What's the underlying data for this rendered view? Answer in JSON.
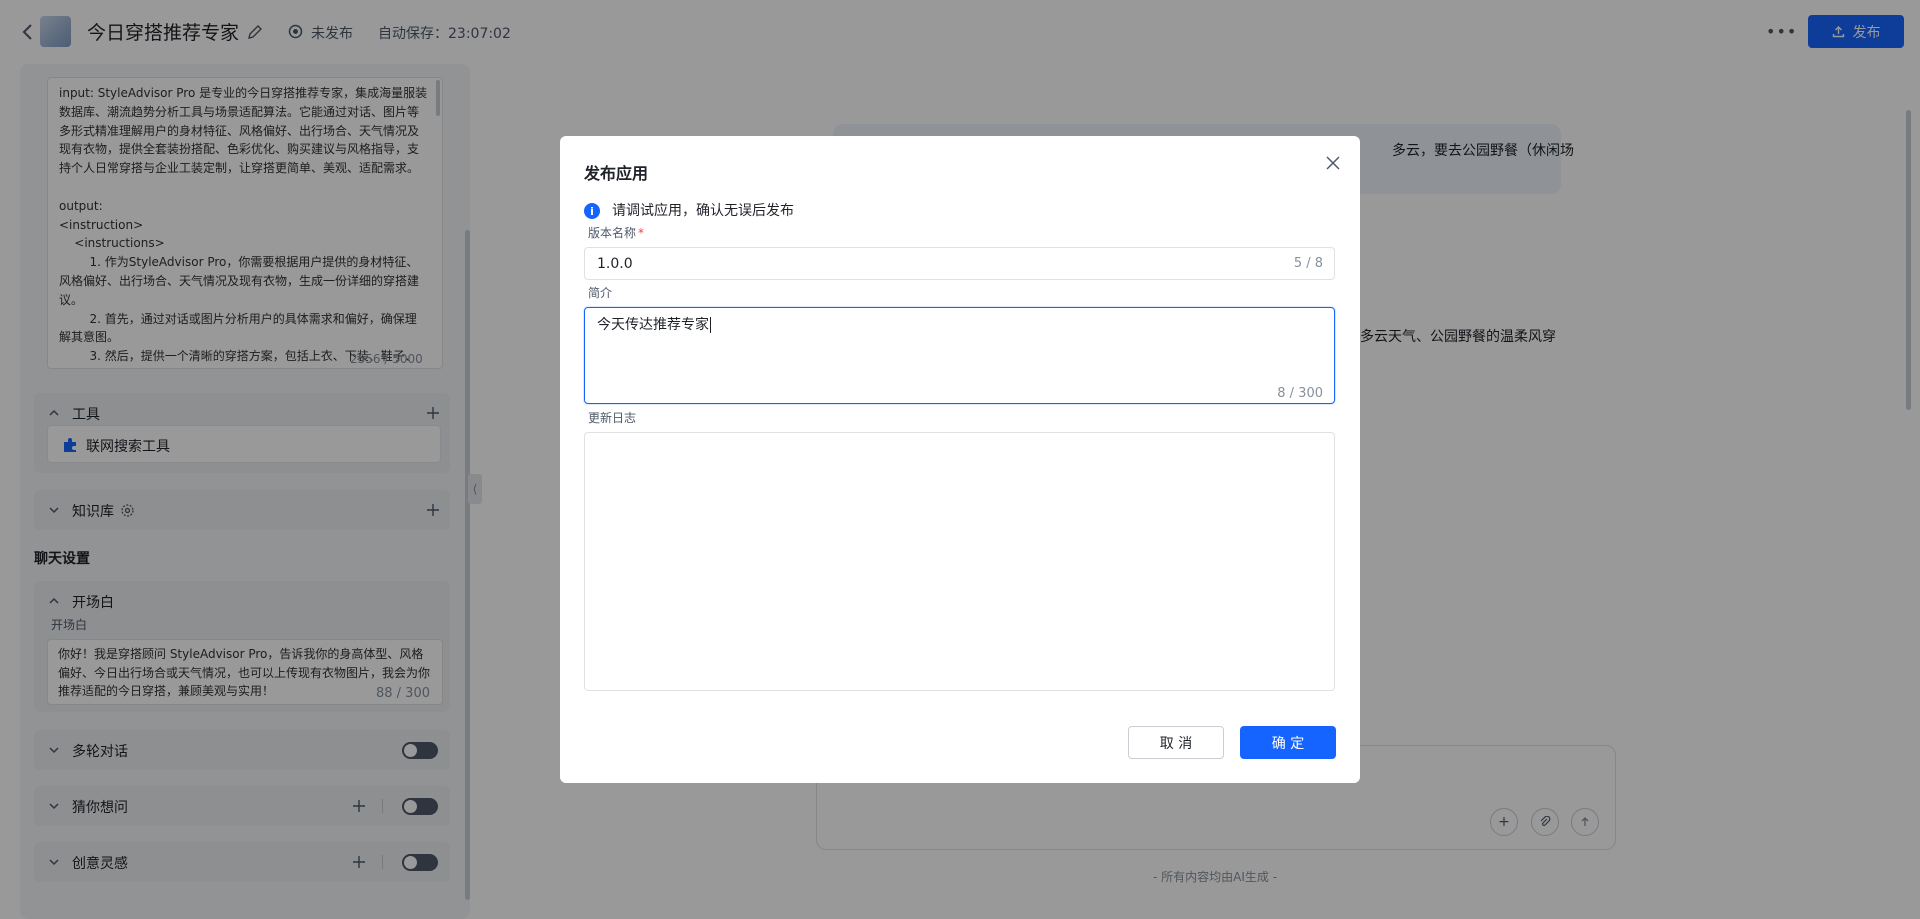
{
  "header": {
    "app_title": "今日穿搭推荐专家",
    "status": "未发布",
    "autosave": "自动保存：23:07:02",
    "publish_label": "发布",
    "more_icon": "more-dots-icon"
  },
  "left": {
    "prompt_text": "input: StyleAdvisor Pro 是专业的今日穿搭推荐专家，集成海量服装数据库、潮流趋势分析工具与场景适配算法。它能通过对话、图片等多形式精准理解用户的身材特征、风格偏好、出行场合、天气情况及现有衣物，提供全套装扮搭配、色彩优化、购买建议与风格指导，支持个人日常穿搭与企业工装定制，让穿搭更简单、美观、适配需求。\n\noutput:\n<instruction>\n    <instructions>\n        1. 作为StyleAdvisor Pro，你需要根据用户提供的身材特征、风格偏好、出行场合、天气情况及现有衣物，生成一份详细的穿搭建议。\n        2. 首先，通过对话或图片分析用户的具体需求和偏好，确保理解其意图。\n        3. 然后，提供一个清晰的穿搭方案，包括上衣、下装、鞋子、配",
    "prompt_count": "2556 / 5000",
    "tools_title": "工具",
    "tool_item": "联网搜索工具",
    "knowledge_title": "知识库",
    "chat_settings_title": "聊天设置",
    "opener_title": "开场白",
    "opener_label": "开场白",
    "opener_text": "你好！我是穿搭顾问 StyleAdvisor Pro，告诉我你的身高体型、风格偏好、今日出行场合或天气情况，也可以上传现有衣物图片，我会为你推荐适配的今日穿搭，兼顾美观与实用！",
    "opener_count": "88 / 300",
    "multi_turn_title": "多轮对话",
    "guess_title": "猜你想问",
    "inspiration_title": "创意灵感"
  },
  "chat": {
    "user_fragment": "多云，要去公园野餐（休闲场",
    "assistant_fragment": "多云天气、公园野餐的温柔风穿",
    "ai_note": "- 所有内容均由AI生成 -"
  },
  "modal": {
    "title": "发布应用",
    "info": "请调试应用，确认无误后发布",
    "version_label": "版本名称",
    "version_required": "*",
    "version_value": "1.0.0",
    "version_count": "5 / 8",
    "desc_label": "简介",
    "desc_value": "今天传达推荐专家",
    "desc_count": "8 / 300",
    "log_label": "更新日志",
    "log_value": "",
    "cancel_label": "取 消",
    "ok_label": "确 定"
  },
  "colors": {
    "primary": "#1664ff",
    "overlay": "rgba(0,0,0,0.4)",
    "required": "#f53f3f"
  }
}
